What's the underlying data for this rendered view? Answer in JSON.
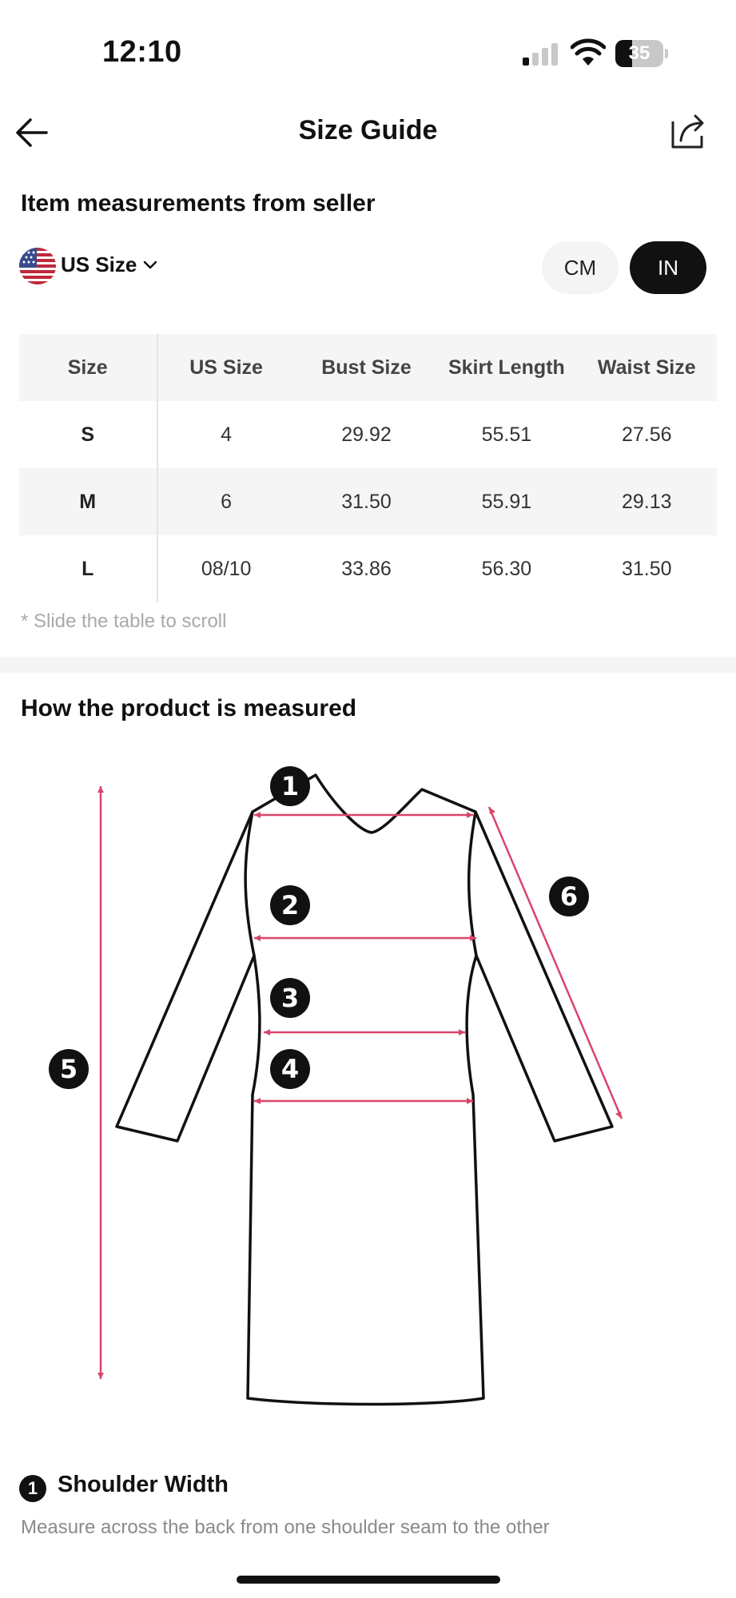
{
  "status_bar": {
    "time": "12:10",
    "battery": "35",
    "battery_level": 0.35
  },
  "header": {
    "title": "Size Guide",
    "back_icon": "arrow-left-icon",
    "share_icon": "share-icon"
  },
  "measurements": {
    "title": "Item measurements from seller",
    "size_system": "US Size",
    "flag_icon": "us-flag-icon",
    "units": [
      {
        "label": "CM",
        "active": false
      },
      {
        "label": "IN",
        "active": true
      }
    ],
    "table": {
      "headers": [
        "Size",
        "US Size",
        "Bust Size",
        "Skirt Length",
        "Waist Size"
      ],
      "rows": [
        [
          "S",
          "4",
          "29.92",
          "55.51",
          "27.56"
        ],
        [
          "M",
          "6",
          "31.50",
          "55.91",
          "29.13"
        ],
        [
          "L",
          "08/10",
          "33.86",
          "56.30",
          "31.50"
        ]
      ]
    },
    "hint": "* Slide the table to scroll"
  },
  "how_measured": {
    "title": "How the product is measured",
    "markers": [
      "1",
      "2",
      "3",
      "4",
      "5",
      "6"
    ],
    "accent_color": "#d9456a",
    "definition": {
      "number": "1",
      "title": "Shoulder Width",
      "description": "Measure across the back from one shoulder seam to the other"
    }
  }
}
